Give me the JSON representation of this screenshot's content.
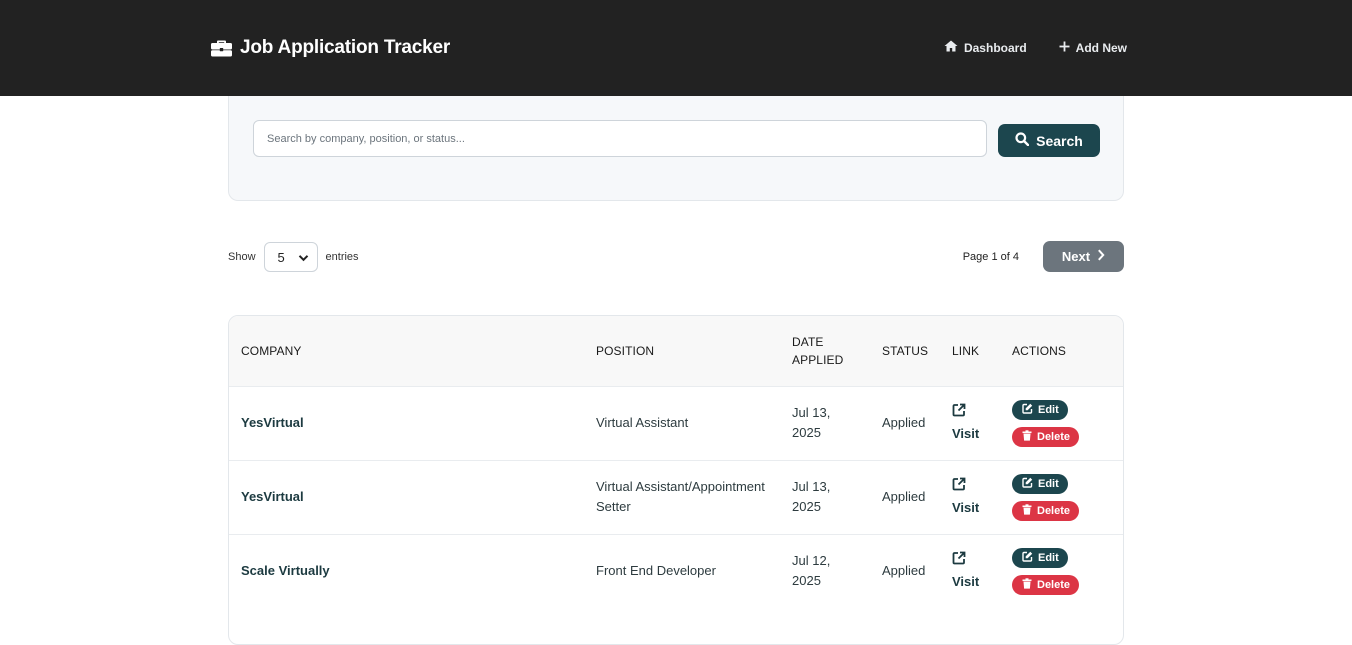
{
  "nav": {
    "brand": "Job Application Tracker",
    "brand_icon": "briefcase-icon",
    "links": [
      {
        "label": "Dashboard",
        "icon": "home-icon"
      },
      {
        "label": "Add New",
        "icon": "plus-icon"
      }
    ],
    "bg_color": "#222222"
  },
  "search": {
    "placeholder": "Search by company, position, or status...",
    "value": "",
    "button_label": "Search",
    "button_color": "#1c464e"
  },
  "controls": {
    "show_label": "Show",
    "entries_value": "5",
    "entries_label": "entries",
    "page_info": "Page 1 of 4",
    "next_label": "Next"
  },
  "table": {
    "headers": {
      "company": "COMPANY",
      "position": "POSITION",
      "date": "DATE APPLIED",
      "status": "STATUS",
      "link": "LINK",
      "actions": "ACTIONS"
    },
    "edit_label": "Edit",
    "delete_label": "Delete",
    "visit_label": "Visit",
    "rows": [
      {
        "company": "YesVirtual",
        "position": "Virtual Assistant",
        "date": "Jul 13, 2025",
        "status": "Applied"
      },
      {
        "company": "YesVirtual",
        "position": "Virtual Assistant/Appointment Setter",
        "date": "Jul 13, 2025",
        "status": "Applied"
      },
      {
        "company": "Scale Virtually",
        "position": "Front End Developer",
        "date": "Jul 12, 2025",
        "status": "Applied"
      }
    ]
  },
  "colors": {
    "accent": "#1c464e",
    "danger": "#dc3545",
    "secondary": "#6c757d"
  }
}
